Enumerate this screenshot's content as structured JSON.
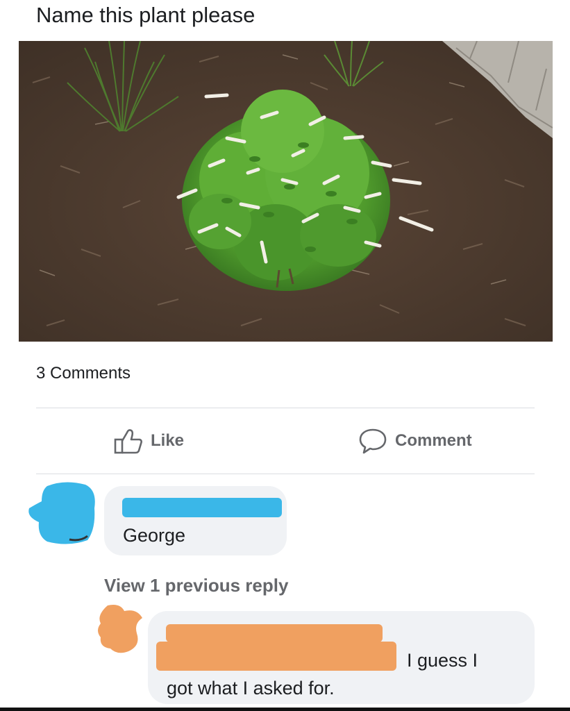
{
  "post": {
    "text": "Name this plant please"
  },
  "stats": {
    "comment_count": "3 Comments"
  },
  "actions": {
    "like_label": "Like",
    "comment_label": "Comment"
  },
  "comments": [
    {
      "author": "",
      "text": "George"
    }
  ],
  "replies": {
    "view_previous": "View 1 previous reply",
    "items": [
      {
        "author": "",
        "text_line1": "I guess I",
        "text_line2": "got what I asked for."
      }
    ]
  },
  "colors": {
    "redaction_blue": "#3ab7e8",
    "redaction_orange": "#f0a060",
    "bubble": "#f0f2f5",
    "action_gray": "#65676b"
  },
  "icons": [
    "thumbs-up-icon",
    "comment-icon"
  ]
}
